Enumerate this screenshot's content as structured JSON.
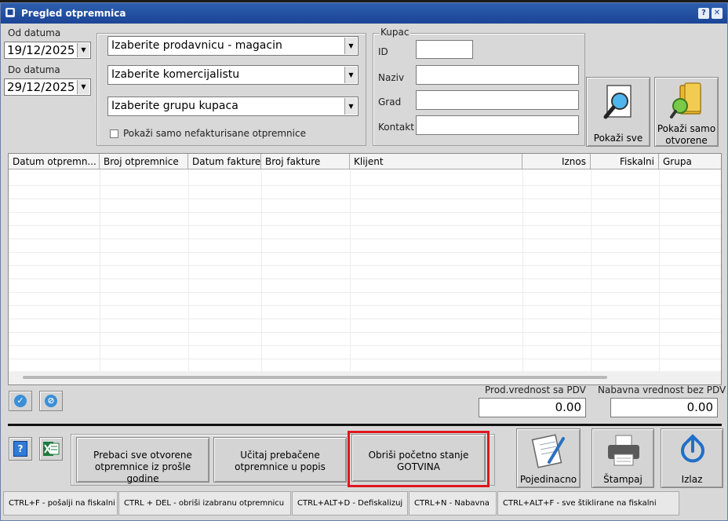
{
  "window": {
    "title": "Pregled otpremnica",
    "help_glyph": "?",
    "close_glyph": "✕"
  },
  "filters": {
    "od_label": "Od datuma",
    "od_value": "19/12/2025",
    "do_label": "Do datuma",
    "do_value": "29/12/2025",
    "prodavnica": "Izaberite prodavnicu - magacin",
    "komercijalista": "Izaberite komercijalistu",
    "grupa_kupaca": "Izaberite grupu kupaca",
    "nefakturisane_label": "Pokaži samo nefakturisane otpremnice"
  },
  "kupac": {
    "group_label": "Kupac",
    "id_label": "ID",
    "naziv_label": "Naziv",
    "grad_label": "Grad",
    "kontakt_label": "Kontakt"
  },
  "actions": {
    "pokazi_sve": "Pokaži sve",
    "pokazi_otvorene": "Pokaži samo otvorene"
  },
  "grid": {
    "columns": [
      "Datum otpremn...",
      "Broj otpremnice",
      "Datum fakture",
      "Broj fakture",
      "Klijent",
      "Iznos",
      "Fiskalni",
      "Grupa"
    ]
  },
  "totals": {
    "prod_label": "Prod.vrednost sa PDV",
    "prod_value": "0.00",
    "nab_label": "Nabavna vrednost bez PDV",
    "nab_value": "0.00"
  },
  "bottom": {
    "help_glyph": "?",
    "prebaci": "Prebaci sve otvorene otpremnice iz prošle godine",
    "ucitaj": "Učitaj prebačene otpremnice u popis",
    "obrisi": "Obriši početno stanje GOTVINA",
    "pojedinacno": "Pojedinacno",
    "stampaj": "Štampaj",
    "izlaz": "Izlaz"
  },
  "status": [
    "CTRL+F - pošalji na fiskalni",
    "CTRL + DEL - obriši izabranu otpremnicu",
    "CTRL+ALT+D - Defiskalizuj",
    "CTRL+N - Nabavna",
    "CTRL+ALT+F - sve štiklirane na fiskalni"
  ],
  "colors": {
    "title_bar": "#1c4596",
    "highlight": "#e0161e"
  }
}
